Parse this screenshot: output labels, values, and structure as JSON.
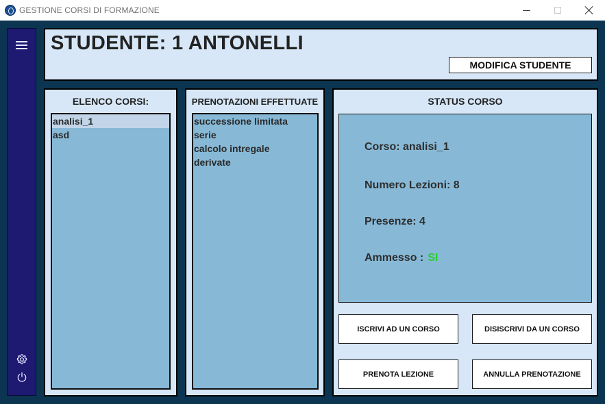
{
  "window": {
    "title": "GESTIONE CORSI DI FORMAZIONE"
  },
  "header": {
    "student_title": "STUDENTE: 1 ANTONELLI",
    "modify_button": "MODIFICA STUDENTE"
  },
  "courses": {
    "heading": "ELENCO CORSI:",
    "items": [
      "analisi_1",
      "asd"
    ],
    "selected_index": 0
  },
  "bookings": {
    "heading": "PRENOTAZIONI EFFETTUATE",
    "items": [
      "successione limitata",
      "serie",
      "calcolo intregale",
      "derivate"
    ]
  },
  "status": {
    "heading": "STATUS CORSO",
    "course_text": "Corso: analisi_1",
    "lessons_text": "Numero Lezioni: 8",
    "attendance_text": "Presenze: 4",
    "admitted_label": "Ammesso :",
    "admitted_value": "SI"
  },
  "actions": {
    "enroll": "ISCRIVI AD UN CORSO",
    "unenroll": "DISISCRIVI DA UN CORSO",
    "book": "PRENOTA LEZIONE",
    "cancel_booking": "ANNULLA PRENOTAZIONE"
  },
  "colors": {
    "background": "#0b3550",
    "sidebar": "#1e1a72",
    "panel": "#d7e7f7",
    "list": "#87b9d7",
    "selected": "#c2d5e8",
    "admitted": "#27d027"
  },
  "icons": {
    "app": "app-logo-icon",
    "menu": "hamburger-menu-icon",
    "settings": "gear-icon",
    "power": "power-icon"
  }
}
